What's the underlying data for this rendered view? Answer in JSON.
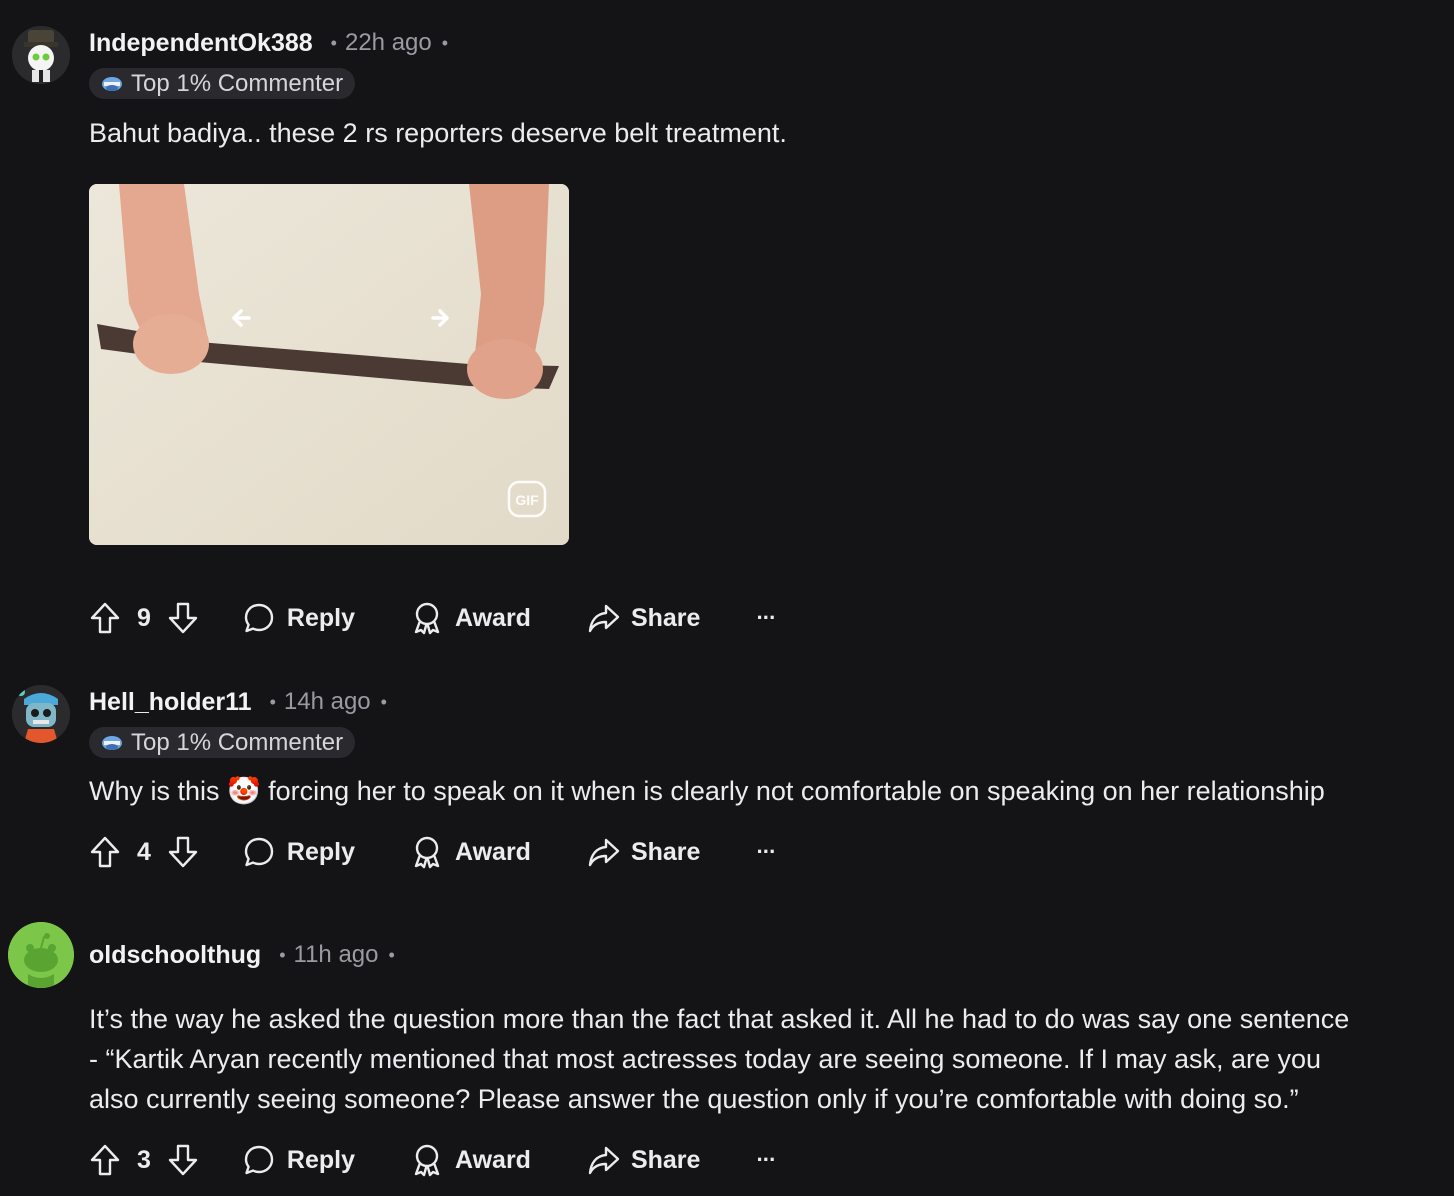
{
  "comments": [
    {
      "username": "IndependentOk388",
      "time": "22h ago",
      "flair": "Top 1% Commenter",
      "body": "Bahut badiya.. these 2 rs reporters deserve belt treatment.",
      "media_badge": "GIF",
      "votes": "9",
      "reply": "Reply",
      "award": "Award",
      "share": "Share",
      "more": "···"
    },
    {
      "username": "Hell_holder11",
      "time": "14h ago",
      "flair": "Top 1% Commenter",
      "body_before_emoji": "Why is this ",
      "emoji": "🤡",
      "body_after_emoji": " forcing her to speak on it when is clearly not comfortable on speaking on her relationship",
      "votes": "4",
      "reply": "Reply",
      "award": "Award",
      "share": "Share",
      "more": "···"
    },
    {
      "username": "oldschoolthug",
      "time": "11h ago",
      "body_lines": [
        "It’s the way he asked the question more than the fact that asked it. All he had to do was say one sentence",
        "- “Kartik Aryan recently mentioned that most actresses today are seeing someone. If I may ask, are you",
        "also currently seeing someone? Please answer the question only if you’re comfortable with doing so.”"
      ],
      "votes": "3",
      "reply": "Reply",
      "award": "Award",
      "share": "Share",
      "more": "···"
    }
  ],
  "colors": {
    "background": "#141316",
    "text": "#ececee",
    "muted": "#9a9aa0",
    "flair_bg": "#2a2a2e"
  }
}
